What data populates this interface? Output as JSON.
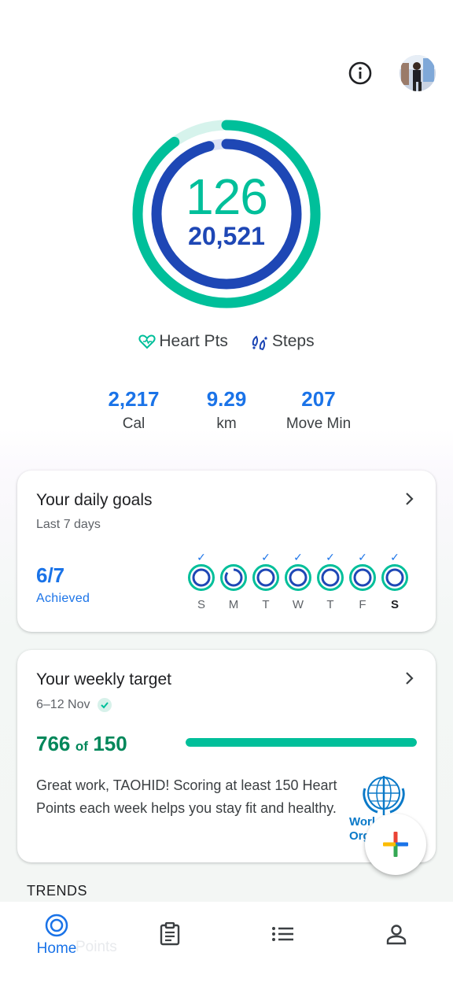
{
  "header": {
    "info_icon": "info-icon",
    "avatar": "profile-avatar"
  },
  "ring": {
    "heart_points": "126",
    "steps": "20,521",
    "heart_points_progress": 0.9,
    "steps_progress": 0.96,
    "colors": {
      "heart": "#00bf9a",
      "steps": "#1e47b5"
    }
  },
  "legend": {
    "heart_label": "Heart Pts",
    "steps_label": "Steps"
  },
  "stats": [
    {
      "value": "2,217",
      "label": "Cal"
    },
    {
      "value": "9.29",
      "label": "km"
    },
    {
      "value": "207",
      "label": "Move Min"
    }
  ],
  "daily_goals": {
    "title": "Your daily goals",
    "subtitle": "Last 7 days",
    "count": "6/7",
    "achieved_label": "Achieved",
    "days": [
      {
        "label": "S",
        "achieved": true,
        "today": false
      },
      {
        "label": "M",
        "achieved": false,
        "today": false
      },
      {
        "label": "T",
        "achieved": true,
        "today": false
      },
      {
        "label": "W",
        "achieved": true,
        "today": false
      },
      {
        "label": "T",
        "achieved": true,
        "today": false
      },
      {
        "label": "F",
        "achieved": true,
        "today": false
      },
      {
        "label": "S",
        "achieved": true,
        "today": true
      }
    ]
  },
  "weekly_target": {
    "title": "Your weekly target",
    "date_range": "6–12 Nov",
    "current": "766",
    "of_label": "of",
    "goal": "150",
    "progress": 1.0,
    "message": "Great work, TAOHID! Scoring at least 150 Heart Points each week helps you stay fit and healthy.",
    "logo_text": "World Health Organization"
  },
  "trends_label": "TRENDS",
  "fab": {
    "icon": "add-icon"
  },
  "bottom_nav": {
    "home_label": "Home",
    "ghost_label": "Points",
    "items": [
      "home-icon",
      "journal-icon",
      "browse-icon",
      "profile-icon"
    ]
  }
}
